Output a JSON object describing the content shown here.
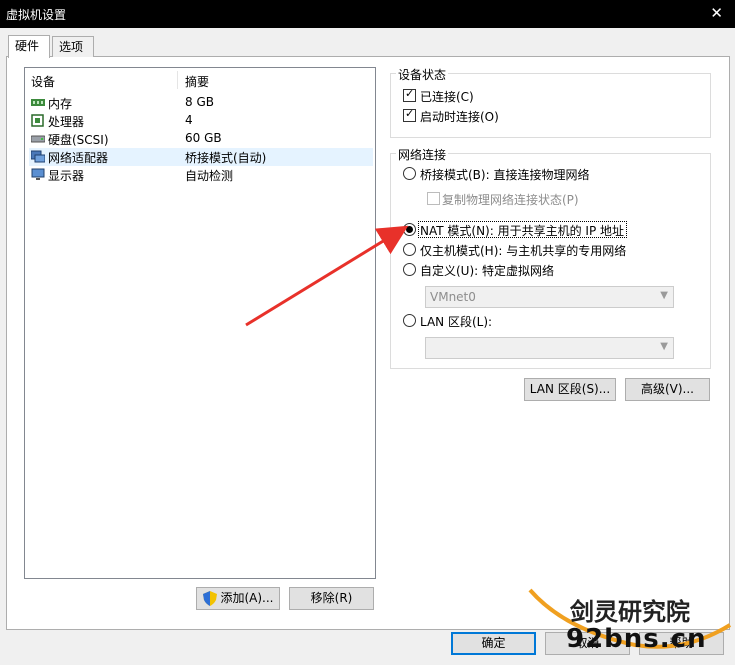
{
  "window": {
    "title": "虚拟机设置",
    "close_glyph": "✕"
  },
  "tabs": [
    {
      "label": "硬件"
    },
    {
      "label": "选项"
    }
  ],
  "devices": {
    "col_device": "设备",
    "col_summary": "摘要",
    "rows": [
      {
        "name": "内存",
        "summary": "8 GB",
        "icon": "memory-icon"
      },
      {
        "name": "处理器",
        "summary": "4",
        "icon": "cpu-icon"
      },
      {
        "name": "硬盘(SCSI)",
        "summary": "60 GB",
        "icon": "disk-icon"
      },
      {
        "name": "网络适配器",
        "summary": "桥接模式(自动)",
        "icon": "network-adapter-icon"
      },
      {
        "name": "显示器",
        "summary": "自动检测",
        "icon": "display-icon"
      }
    ],
    "add_button": "添加(A)...",
    "remove_button": "移除(R)"
  },
  "device_status": {
    "title": "设备状态",
    "connected": "已连接(C)",
    "connect_on_start": "启动时连接(O)"
  },
  "network": {
    "title": "网络连接",
    "bridged": "桥接模式(B): 直接连接物理网络",
    "replicate": "复制物理网络连接状态(P)",
    "nat": "NAT 模式(N): 用于共享主机的 IP 地址",
    "host_only": "仅主机模式(H): 与主机共享的专用网络",
    "custom": "自定义(U): 特定虚拟网络",
    "custom_value": "VMnet0",
    "lan_segment": "LAN 区段(L):",
    "lan_value": "",
    "selected": "nat"
  },
  "buttons": {
    "lan_segments": "LAN 区段(S)...",
    "advanced": "高级(V)...",
    "ok": "确定",
    "cancel": "取消",
    "help": "帮助"
  },
  "watermark": {
    "line1": "剑灵研究院",
    "line2": "92bns.cn"
  },
  "colors": {
    "arrow": "#e8312a",
    "accent": "#0078d7",
    "selection": "#e5f3ff"
  }
}
